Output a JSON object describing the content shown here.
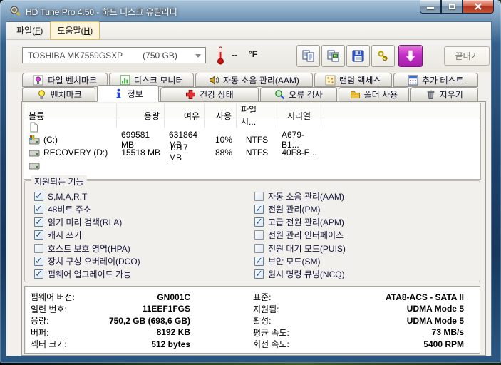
{
  "theme": {
    "titlebar_blue": "#1d4068",
    "update_button_magenta": "#C32FC6",
    "close_button_red": "#B03420",
    "active_tab_bg": "#FFFFFF",
    "check_blue": "#1F4E9C"
  },
  "window": {
    "title": "HD Tune Pro 4.50 - 하드 디스크 유틸리티"
  },
  "menu": {
    "file": {
      "pre": "파일(",
      "key": "F",
      "post": ")"
    },
    "help": {
      "pre": "도움말(",
      "key": "H",
      "post": ")"
    }
  },
  "toolbar": {
    "drive_select": {
      "model": "TOSHIBA MK7559GSXP",
      "capacity": "(750 GB)"
    },
    "temperature": {
      "value": "--",
      "unit": "°F"
    },
    "buttons": [
      {
        "icon": "copy-text-icon"
      },
      {
        "icon": "copy-image-icon"
      },
      {
        "icon": "save-icon"
      },
      {
        "icon": "options-icon"
      },
      {
        "icon": "download-arrow-icon"
      }
    ],
    "exit_label": "끝내기"
  },
  "tabs": {
    "active": "정보",
    "row1": [
      {
        "label": "파일 벤치마크",
        "icon": "file-benchmark-icon"
      },
      {
        "label": "디스크 모니터",
        "icon": "disk-monitor-icon"
      },
      {
        "label": "자동 소음 관리(AAM)",
        "icon": "speaker-icon"
      },
      {
        "label": "랜덤 액세스",
        "icon": "random-access-icon"
      },
      {
        "label": "추가 테스트",
        "icon": "extra-tests-icon"
      }
    ],
    "row2": [
      {
        "label": "벤치마크",
        "icon": "bulb-icon"
      },
      {
        "label": "정보",
        "icon": "info-icon"
      },
      {
        "label": "건강 상태",
        "icon": "health-cross-icon"
      },
      {
        "label": "오류 검사",
        "icon": "magnifier-icon"
      },
      {
        "label": "폴더 사용",
        "icon": "folder-icon"
      },
      {
        "label": "지우기",
        "icon": "trash-icon"
      }
    ]
  },
  "volumes": {
    "columns": [
      "볼륨",
      "용량",
      "여유",
      "사용",
      "파일 시...",
      "시리얼"
    ],
    "rows": [
      {
        "icon": "file-icon",
        "name": "",
        "capacity": "",
        "free": "",
        "used": "",
        "filesystem": "",
        "serial": ""
      },
      {
        "icon": "system-drive-icon",
        "name": "(C:)",
        "capacity": "699581 MB",
        "free": "631864 MB",
        "used": "10%",
        "filesystem": "NTFS",
        "serial": "A679-B1..."
      },
      {
        "icon": "drive-icon",
        "name": "RECOVERY (D:)",
        "capacity": "15518 MB",
        "free": "1917 MB",
        "used": "88%",
        "filesystem": "NTFS",
        "serial": "40F8-E..."
      },
      {
        "icon": "drive-icon",
        "name": "",
        "capacity": "",
        "free": "",
        "used": "",
        "filesystem": "",
        "serial": ""
      }
    ]
  },
  "features": {
    "title": "지원되는 기능",
    "left": [
      {
        "label": "S,M,A,R,T",
        "checked": true
      },
      {
        "label": "48비트 주소",
        "checked": true
      },
      {
        "label": "읽기 미리 검색(RLA)",
        "checked": true
      },
      {
        "label": "캐시 쓰기",
        "checked": true
      },
      {
        "label": "호스트 보호 영역(HPA)",
        "checked": false
      },
      {
        "label": "장치 구성 오버레이(DCO)",
        "checked": true
      },
      {
        "label": "펌웨어 업그레이드 가능",
        "checked": true
      }
    ],
    "right": [
      {
        "label": "자동 소음 관리(AAM)",
        "checked": false
      },
      {
        "label": "전원 관리(PM)",
        "checked": true
      },
      {
        "label": "고급 전원 관리(APM)",
        "checked": true
      },
      {
        "label": "전원 관리 인터페이스",
        "checked": false
      },
      {
        "label": "전원 대기 모드(PUIS)",
        "checked": false
      },
      {
        "label": "보안 모드(SM)",
        "checked": true
      },
      {
        "label": "원시 명령 큐닝(NCQ)",
        "checked": true
      }
    ]
  },
  "details": {
    "left": [
      {
        "label": "펌웨어 버전:",
        "value": "GN001C"
      },
      {
        "label": "일련 번호:",
        "value": "11EEF1FGS"
      },
      {
        "label": "용량:",
        "value": "750,2 GB (698,6 GB)"
      },
      {
        "label": "버퍼:",
        "value": "8192 KB"
      },
      {
        "label": "섹터 크기:",
        "value": "512 bytes"
      }
    ],
    "right": [
      {
        "label": "표준:",
        "value": "ATA8-ACS - SATA II"
      },
      {
        "label": "지원됨:",
        "value": "UDMA Mode 5"
      },
      {
        "label": "활성:",
        "value": "UDMA Mode 5"
      },
      {
        "label": "평균 속도:",
        "value": "73 MB/s"
      },
      {
        "label": "회전 속도:",
        "value": "5400 RPM"
      }
    ]
  }
}
